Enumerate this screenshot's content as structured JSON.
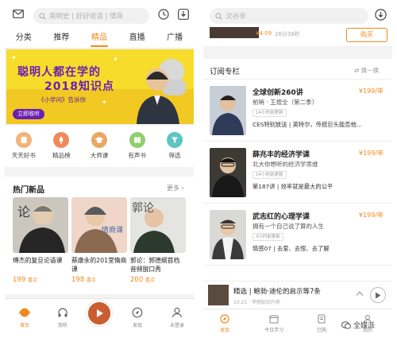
{
  "colors": {
    "accent": "#f08a1d",
    "banner_bg": "#f6dd2c",
    "banner_text": "#6b1fb2"
  },
  "left": {
    "search_placeholder": "南明史 | 好好说话 | 情商",
    "tabs": [
      "分类",
      "推荐",
      "精品",
      "直播",
      "广播"
    ],
    "active_tab": "精品",
    "banner": {
      "line1": "聪明人都在学的",
      "line2": "2018知识点",
      "subtitle": "《小学问》告诉你",
      "button": "立即收听"
    },
    "categories": [
      {
        "label": "天天好书",
        "icon": "book-icon",
        "color": "#f3b37a"
      },
      {
        "label": "精品榜",
        "icon": "rocket-icon",
        "color": "#f08a5a"
      },
      {
        "label": "大师课",
        "icon": "graduation-cap-icon",
        "color": "#e8a762"
      },
      {
        "label": "有声书",
        "icon": "audiobook-icon",
        "color": "#8fcf6f"
      },
      {
        "label": "筛选",
        "icon": "filter-icon",
        "color": "#5cc6c2"
      }
    ],
    "hot_section": {
      "title": "热门新品",
      "more": "更多 ›",
      "books": [
        {
          "title": "傅杰的复旦论语课",
          "price": "199",
          "unit": "喜点",
          "cover_text": "论"
        },
        {
          "title": "蔡康永的201堂情商课",
          "price": "198",
          "unit": "喜点",
          "cover_text": "情商课"
        },
        {
          "title": "郭论：郭德纲首档音频脱口秀",
          "price": "200",
          "unit": "喜点",
          "cover_text": "郭论"
        }
      ]
    },
    "nav": [
      "首页",
      "我听",
      "",
      "发现",
      "未登录"
    ]
  },
  "right": {
    "search_placeholder": "沈谷非",
    "peek": {
      "price": "¥4.09",
      "meta": "26分38秒",
      "button": "购买"
    },
    "section_title": "订阅专栏",
    "refresh": "换一换",
    "courses": [
      {
        "title": "全球创新260讲",
        "price": "¥199/年",
        "author": "前哨 · 王煜全（第二季）",
        "badge": "14小时前更新",
        "latest": "CES特别放送 | 英特尔，传统巨头能否他..."
      },
      {
        "title": "薛兆丰的经济学课",
        "price": "¥199/年",
        "author": "北大你想听的经济学思维",
        "badge": "14小时前更新",
        "latest": "第187讲 | 效率就是最大的公平"
      },
      {
        "title": "武志红的心理学课",
        "price": "¥199/年",
        "author": "拥有一个自己说了算的人生",
        "badge": "3小时前更新",
        "latest": "情感07 | 去爱、去恨、去了解"
      }
    ],
    "player": {
      "title": "精选 | 鲍勃·迪伦的启示等7条",
      "sub": "10:21 · 李翔知识内参"
    },
    "nav": [
      "发现",
      "今日学习",
      "已购",
      "我的"
    ]
  },
  "watermark": "全媒派"
}
